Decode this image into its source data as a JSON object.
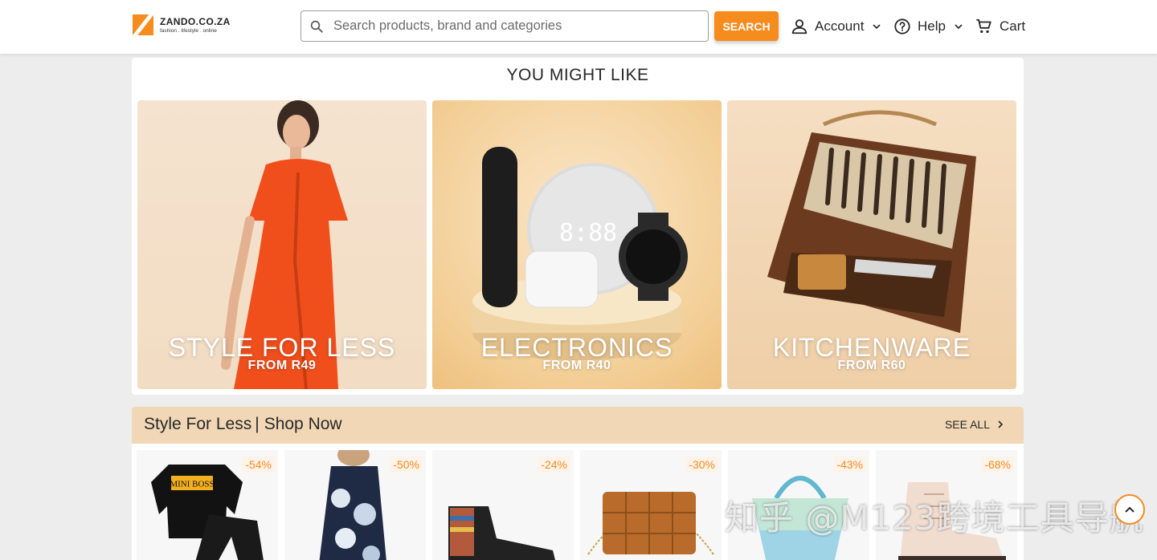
{
  "header": {
    "logo_name": "ZANDO.CO.ZA",
    "logo_tagline": "fashion . lifestyle . online",
    "search_placeholder": "Search products, brand and categories",
    "search_button": "SEARCH",
    "account_label": "Account",
    "help_label": "Help",
    "cart_label": "Cart"
  },
  "you_might_like": {
    "title": "YOU MIGHT LIKE",
    "banners": [
      {
        "title": "STYLE FOR LESS",
        "subtitle": "FROM R49"
      },
      {
        "title": "ELECTRONICS",
        "subtitle": "FROM R40"
      },
      {
        "title": "KITCHENWARE",
        "subtitle": "FROM R60"
      }
    ]
  },
  "style_for_less": {
    "title": "Style For Less",
    "separator": "|",
    "subtitle": "Shop Now",
    "see_all": "SEE ALL",
    "products": [
      {
        "discount": "-54%"
      },
      {
        "discount": "-50%"
      },
      {
        "discount": "-24%"
      },
      {
        "discount": "-30%"
      },
      {
        "discount": "-43%"
      },
      {
        "discount": "-68%"
      }
    ]
  },
  "product_1_print": "MINI BOSS",
  "watermark": "知乎 @M123跨境工具导航",
  "colors": {
    "accent": "#f68b1e",
    "section_bar": "#f1d7b6",
    "page_bg": "#ededed"
  },
  "icons": [
    "search-icon",
    "person-icon",
    "help-circle-icon",
    "cart-icon",
    "chevron-down-icon",
    "chevron-right-icon",
    "chevron-up-icon"
  ]
}
